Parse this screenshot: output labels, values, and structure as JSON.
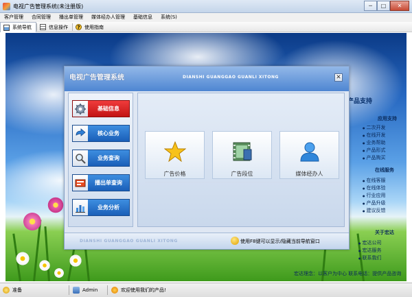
{
  "window": {
    "title": "电视广告管理系统(未注册版)",
    "min": "─",
    "max": "□",
    "close": "✕"
  },
  "menu": [
    "客户管理",
    "合同管理",
    "播出单管理",
    "媒体经办人管理",
    "基础信息",
    "系统(S)"
  ],
  "toolbar": [
    {
      "label": "系统导航",
      "icon": "navigation-icon",
      "active": true
    },
    {
      "label": "信息操作",
      "icon": "info-icon",
      "active": false
    },
    {
      "label": "使用指南",
      "icon": "help-icon",
      "active": false
    }
  ],
  "desktop": {
    "side_title": "产品支持",
    "groups": [
      {
        "heading": "应用支持",
        "links": [
          "二次开发",
          "在线开发",
          "业务帮助",
          "产品形式",
          "产品购买"
        ]
      },
      {
        "heading": "在线服务",
        "links": [
          "在线客服",
          "在线体验",
          "行业应用",
          "产品升级",
          "建议反馈"
        ]
      },
      {
        "heading": "关于宏达",
        "links": [
          "宏达公司",
          "宏达服务",
          "联系我们"
        ]
      }
    ],
    "footer": "宏达理念：以客户为中心   联系电话：提供产品咨询"
  },
  "nav_window": {
    "title": "电视广告管理系统",
    "pinyin": "DIANSHI GUANGGAO GUANLI XITONG",
    "close": "✕",
    "categories": [
      {
        "label": "基础信息",
        "icon": "gear-icon",
        "active": true
      },
      {
        "label": "核心业务",
        "icon": "arrow-icon",
        "active": false
      },
      {
        "label": "业务查询",
        "icon": "magnifier-icon",
        "active": false
      },
      {
        "label": "播出单查询",
        "icon": "schedule-icon",
        "active": false
      },
      {
        "label": "业务分析",
        "icon": "chart-icon",
        "active": false
      }
    ],
    "tiles": [
      {
        "label": "广告价格",
        "icon": "star-icon"
      },
      {
        "label": "广告段位",
        "icon": "film-icon"
      },
      {
        "label": "媒体经办人",
        "icon": "person-icon"
      }
    ],
    "footer_pinyin": "DIANSHI GUANGGAO GUANLI XITONG",
    "footer_tip": "使用F8键可以显示/隐藏当前导航窗口"
  },
  "status": {
    "ready": "准备",
    "user": "Admin",
    "welcome": "欢迎使用我们的产品!"
  }
}
